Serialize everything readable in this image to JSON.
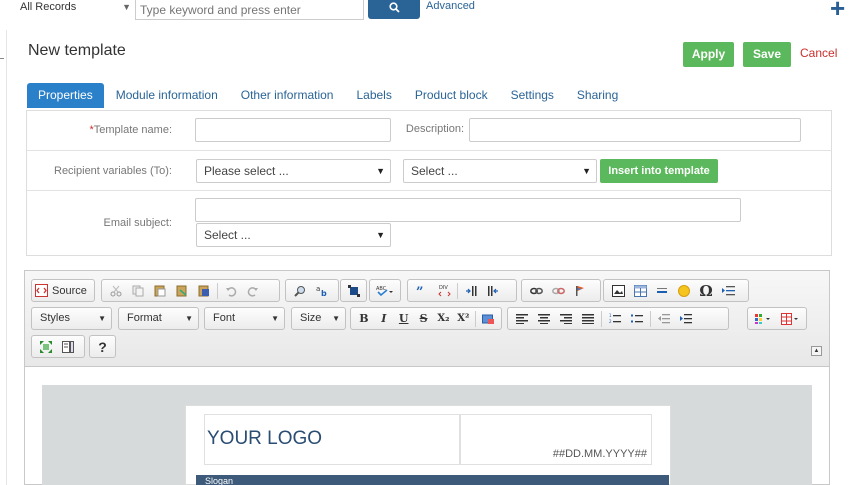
{
  "topbar": {
    "records_select": "All Records",
    "search_placeholder": "Type keyword and press enter",
    "advanced_label": "Advanced"
  },
  "page": {
    "title": "New template",
    "apply_label": "Apply",
    "save_label": "Save",
    "cancel_label": "Cancel"
  },
  "tabs": [
    {
      "label": "Properties",
      "active": true
    },
    {
      "label": "Module information"
    },
    {
      "label": "Other information"
    },
    {
      "label": "Labels"
    },
    {
      "label": "Product block"
    },
    {
      "label": "Settings"
    },
    {
      "label": "Sharing"
    }
  ],
  "form": {
    "template_name_required": "*",
    "template_name_label": "Template name:",
    "template_name_value": "",
    "description_label": "Description:",
    "description_value": "",
    "recipient_label": "Recipient variables (To):",
    "recipient_select": "Please select ...",
    "recipient_select2": "Select ...",
    "insert_label": "Insert into template",
    "email_subject_label": "Email subject:",
    "email_subject_value": "",
    "email_subject_select": "Select ..."
  },
  "editor": {
    "source_label": "Source",
    "styles_label": "Styles",
    "format_label": "Format",
    "font_label": "Font",
    "size_label": "Size",
    "help_label": "?",
    "bold_label": "B",
    "italic_label": "I",
    "underline_label": "U",
    "strike_label": "S",
    "sub_label": "X₂",
    "sup_label": "X²",
    "omega_label": "Ω"
  },
  "template_preview": {
    "logo_text": "YOUR LOGO",
    "date_text": "##DD.MM.YYYY##",
    "slogan_text": "Slogan"
  },
  "colors": {
    "primary": "#2a80c9",
    "success": "#5cb85c",
    "danger": "#c9302c",
    "search_button": "#2a6496"
  }
}
